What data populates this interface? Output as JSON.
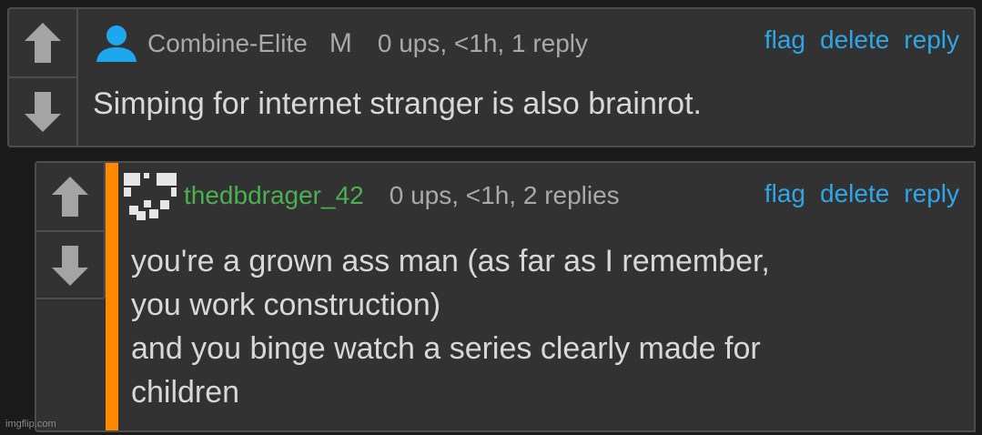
{
  "comments": [
    {
      "username": "Combine-Elite",
      "badge": "M",
      "meta": "0 ups, <1h, 1 reply",
      "actions": {
        "flag": "flag",
        "delete": "delete",
        "reply": "reply"
      },
      "body": "Simping for internet stranger is also brainrot.",
      "avatar_icon": "user-silhouette-icon",
      "avatar_color": "#1ea7ef"
    },
    {
      "username": "thedbdrager_42",
      "meta": "0 ups, <1h, 2 replies",
      "actions": {
        "flag": "flag",
        "delete": "delete",
        "reply": "reply"
      },
      "body_lines": [
        "you're a grown ass man (as far as I remember,",
        "you work construction)",
        "and you binge watch a series clearly made for",
        "children"
      ],
      "avatar_icon": "pixel-avatar-icon",
      "username_color": "#4caf50",
      "accent_color": "#ff8a00"
    }
  ],
  "watermark": "imgflip.com"
}
